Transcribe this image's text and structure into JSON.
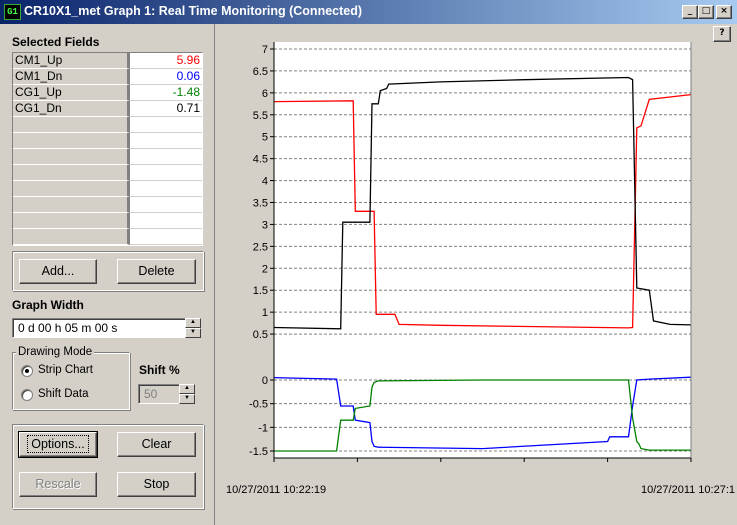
{
  "window": {
    "title": "CR10X1_met Graph 1: Real Time Monitoring (Connected)",
    "icon_text": "G1",
    "controls": [
      "_",
      "□",
      "×"
    ],
    "help_label": "?"
  },
  "selected_fields": {
    "label": "Selected Fields",
    "rows": [
      {
        "name": "CM1_Up",
        "value": "5.96",
        "color": "#ff0000"
      },
      {
        "name": "CM1_Dn",
        "value": "0.06",
        "color": "#0000ff"
      },
      {
        "name": "CG1_Up",
        "value": "-1.48",
        "color": "#008000"
      },
      {
        "name": "CG1_Dn",
        "value": "0.71",
        "color": "#000000"
      },
      {
        "name": "",
        "value": ""
      },
      {
        "name": "",
        "value": ""
      },
      {
        "name": "",
        "value": ""
      },
      {
        "name": "",
        "value": ""
      },
      {
        "name": "",
        "value": ""
      },
      {
        "name": "",
        "value": ""
      },
      {
        "name": "",
        "value": ""
      },
      {
        "name": "",
        "value": ""
      }
    ],
    "add_label": "Add...",
    "delete_label": "Delete"
  },
  "graph_width": {
    "label": "Graph Width",
    "value": "0 d 00 h 05 m 00 s"
  },
  "drawing_mode": {
    "label": "Drawing Mode",
    "options": [
      {
        "label": "Strip Chart",
        "selected": true
      },
      {
        "label": "Shift Data",
        "selected": false
      }
    ]
  },
  "shift": {
    "label": "Shift %",
    "value": "50"
  },
  "buttons": {
    "options": "Options...",
    "clear": "Clear",
    "rescale": "Rescale",
    "stop": "Stop"
  },
  "chart_data": [
    {
      "type": "line",
      "ylim": [
        0,
        7
      ],
      "yticks": [
        "7",
        "6.5",
        "6",
        "5.5",
        "5",
        "4.5",
        "4",
        "3.5",
        "3",
        "2.5",
        "2",
        "1.5",
        "1",
        "0.5"
      ],
      "x_start_label": "10/27/2011 10:22:19",
      "x_end_label": "10/27/2011 10:27:1",
      "series": [
        {
          "name": "CM1_Up",
          "color": "#ff0000",
          "x": [
            0,
            0.19,
            0.195,
            0.24,
            0.245,
            0.29,
            0.3,
            0.4,
            0.85,
            0.86,
            0.87,
            0.88,
            0.9,
            1.0
          ],
          "y": [
            5.8,
            5.82,
            3.3,
            3.3,
            0.95,
            0.95,
            0.72,
            0.7,
            0.64,
            0.65,
            5.2,
            5.25,
            5.85,
            5.96
          ]
        },
        {
          "name": "CG1_Dn",
          "color": "#000000",
          "x": [
            0,
            0.16,
            0.165,
            0.23,
            0.235,
            0.25,
            0.255,
            0.27,
            0.275,
            0.4,
            0.6,
            0.85,
            0.86,
            0.87,
            0.9,
            0.91,
            0.95,
            1.0
          ],
          "y": [
            0.65,
            0.62,
            3.05,
            3.05,
            5.75,
            5.75,
            6.05,
            6.1,
            6.2,
            6.25,
            6.3,
            6.35,
            6.3,
            1.55,
            1.5,
            0.8,
            0.72,
            0.71
          ]
        }
      ]
    },
    {
      "type": "line",
      "ylim": [
        -1.5,
        0
      ],
      "yticks": [
        "0",
        "-0.5",
        "-1",
        "-1.5"
      ],
      "x_start_label": "10/27/2011 10:22:19",
      "x_end_label": "10/27/2011 10:27:1",
      "series": [
        {
          "name": "CM1_Dn",
          "color": "#0000ff",
          "x": [
            0,
            0.15,
            0.16,
            0.19,
            0.195,
            0.23,
            0.235,
            0.24,
            0.25,
            0.5,
            0.8,
            0.805,
            0.85,
            0.86,
            0.87,
            0.9,
            1.0
          ],
          "y": [
            0.05,
            0.02,
            -0.55,
            -0.55,
            -0.85,
            -0.9,
            -1.3,
            -1.4,
            -1.42,
            -1.45,
            -1.3,
            -1.2,
            -1.2,
            -0.55,
            0.0,
            0.02,
            0.06
          ]
        },
        {
          "name": "CG1_Up",
          "color": "#008000",
          "x": [
            0,
            0.15,
            0.16,
            0.19,
            0.195,
            0.23,
            0.235,
            0.24,
            0.25,
            0.5,
            0.85,
            0.86,
            0.87,
            0.875,
            0.88,
            0.9,
            1.0
          ],
          "y": [
            -1.5,
            -1.5,
            -0.85,
            -0.85,
            -0.6,
            -0.55,
            -0.15,
            -0.05,
            -0.02,
            0.0,
            0.0,
            -0.8,
            -1.3,
            -1.35,
            -1.45,
            -1.48,
            -1.48
          ]
        }
      ]
    }
  ]
}
